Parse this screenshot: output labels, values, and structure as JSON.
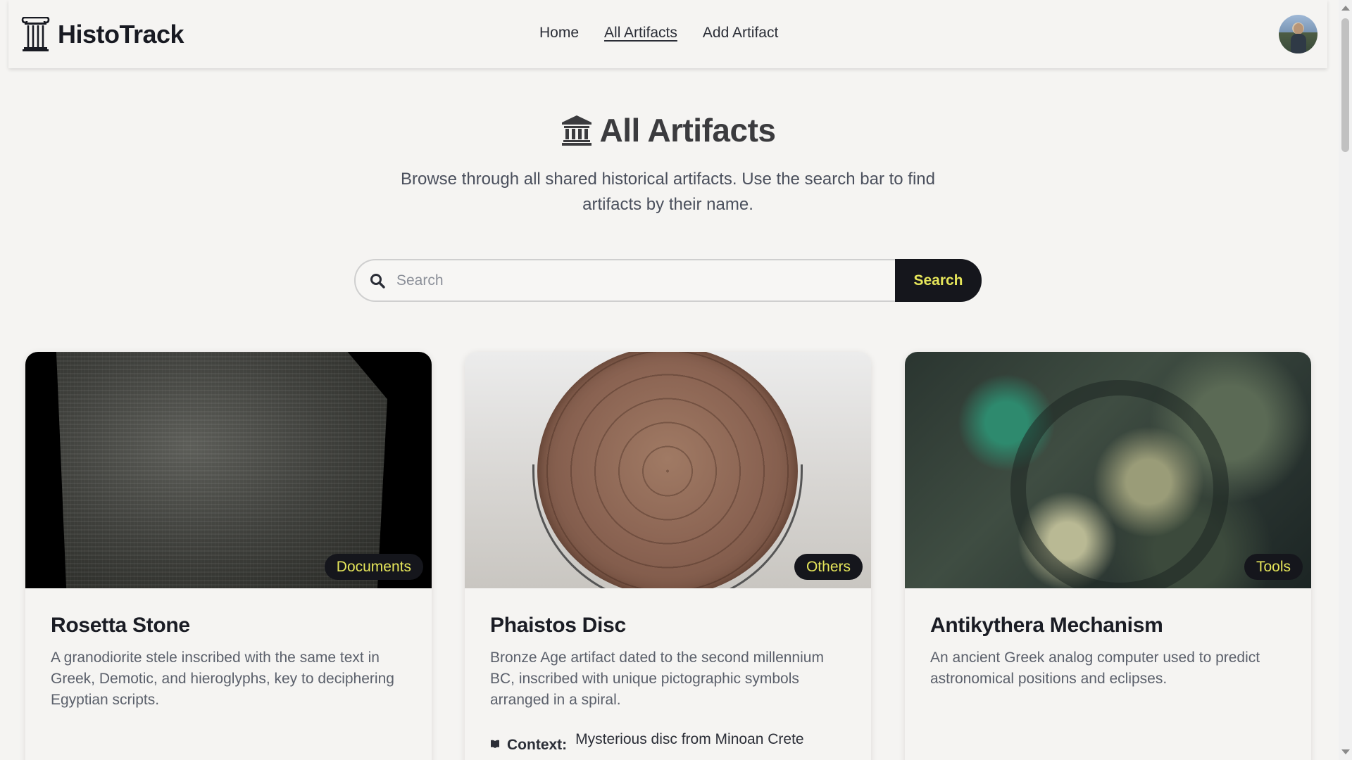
{
  "brand": {
    "name": "HistoTrack",
    "icon": "pillar-icon"
  },
  "nav": {
    "items": [
      {
        "label": "Home",
        "active": false
      },
      {
        "label": "All Artifacts",
        "active": true
      },
      {
        "label": "Add Artifact",
        "active": false
      }
    ]
  },
  "header": {
    "title": "All Artifacts",
    "icon": "museum-icon",
    "subtitle": "Browse through all shared historical artifacts. Use the search bar to find artifacts by their name."
  },
  "search": {
    "placeholder": "Search",
    "value": "",
    "button_label": "Search"
  },
  "colors": {
    "background": "#f5f4f2",
    "accent_dark": "#15161c",
    "accent_text": "#e6e65a"
  },
  "artifacts": [
    {
      "name": "Rosetta Stone",
      "category": "Documents",
      "description": "A granodiorite stele inscribed with the same text in Greek, Demotic, and hieroglyphs, key to deciphering Egyptian scripts.",
      "context_label": "",
      "context": ""
    },
    {
      "name": "Phaistos Disc",
      "category": "Others",
      "description": "Bronze Age artifact dated to the second millennium BC, inscribed with unique pictographic symbols arranged in a spiral.",
      "context_label": "Context:",
      "context": "Mysterious disc from Minoan Crete"
    },
    {
      "name": "Antikythera Mechanism",
      "category": "Tools",
      "description": "An ancient Greek analog computer used to predict astronomical positions and eclipses.",
      "context_label": "",
      "context": ""
    }
  ]
}
